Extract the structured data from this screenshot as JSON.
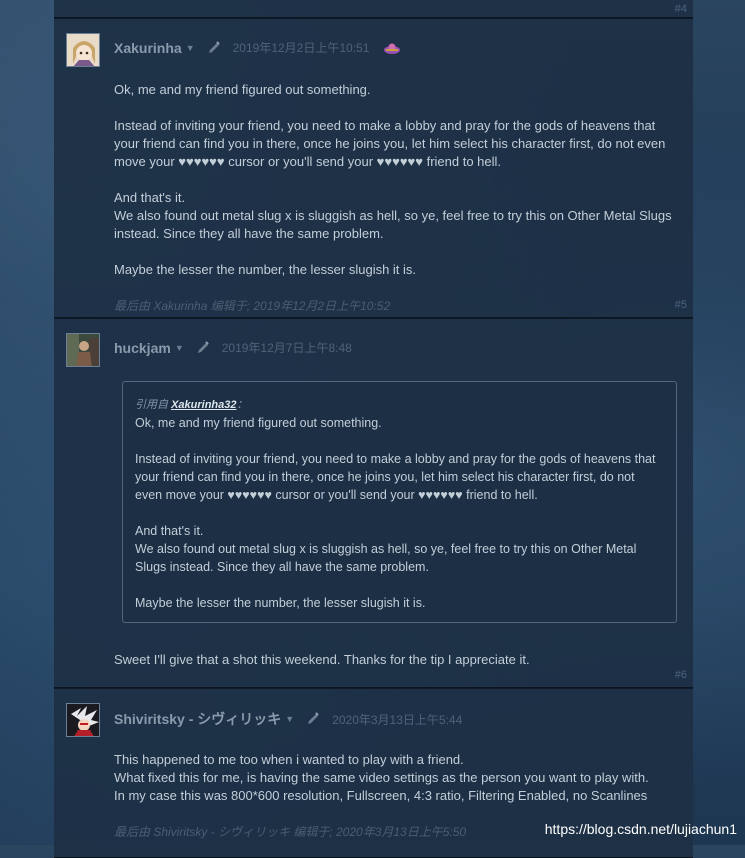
{
  "posts": [
    {
      "number": "#4"
    },
    {
      "number": "#5",
      "author": "Xakurinha",
      "date": "2019年12月2日上午10:51",
      "paragraphs": [
        "Ok, me and my friend figured out something.",
        "Instead of inviting your friend, you need to make a lobby and pray for the gods of heavens that your friend can find you in there, once he joins you, let him select his character first, do not even move your ♥♥♥♥♥♥ cursor or you'll send your ♥♥♥♥♥♥ friend to hell.",
        "And that's it.\nWe also found out metal slug x is sluggish as hell, so ye, feel free to try this on Other Metal Slugs instead. Since they all have the same problem.",
        "Maybe the lesser the number, the lesser slugish it is."
      ],
      "edited": "最后由 Xakurinha 编辑于; 2019年12月2日上午10:52"
    },
    {
      "number": "#6",
      "author": "huckjam",
      "date": "2019年12月7日上午8:48",
      "quote": {
        "prefix": "引用自 ",
        "author": "Xakurinha32",
        "suffix": "：",
        "paragraphs": [
          "Ok, me and my friend figured out something.",
          "Instead of inviting your friend, you need to make a lobby and pray for the gods of heavens that your friend can find you in there, once he joins you, let him select his character first, do not even move your ♥♥♥♥♥♥ cursor or you'll send your ♥♥♥♥♥♥ friend to hell.",
          "And that's it.\nWe also found out metal slug x is sluggish as hell, so ye, feel free to try this on Other Metal Slugs instead. Since they all have the same problem.",
          "Maybe the lesser the number, the lesser slugish it is."
        ]
      },
      "reply": "Sweet I'll give that a shot this weekend. Thanks for the tip I appreciate it."
    },
    {
      "author": "Shiviritsky - シヴィリッキ",
      "date": "2020年3月13日上午5:44",
      "body": "This happened to me too when i wanted to play with a friend.\nWhat fixed this for me, is having the same video settings as the person you want to play with.\nIn my case this was 800*600 resolution, Fullscreen, 4:3 ratio, Filtering Enabled, no Scanlines",
      "edited": "最后由 Shiviritsky - シヴィリッキ 编辑于; 2020年3月13日上午5:50"
    }
  ],
  "watermark": "https://blog.csdn.net/lujiachun1"
}
